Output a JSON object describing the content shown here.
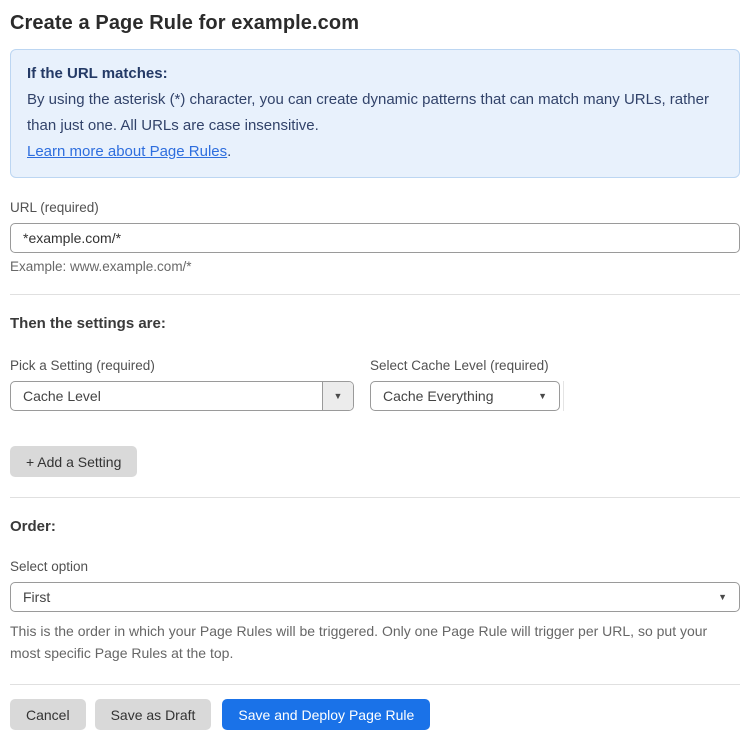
{
  "page": {
    "title": "Create a Page Rule for example.com"
  },
  "info_box": {
    "heading": "If the URL matches:",
    "body": "By using the asterisk (*) character, you can create dynamic patterns that can match many URLs, rather than just one. All URLs are case insensitive.",
    "link_label": "Learn more about Page Rules",
    "link_suffix": "."
  },
  "url_section": {
    "label": "URL (required)",
    "value": "*example.com/*",
    "helper": "Example: www.example.com/*"
  },
  "settings_section": {
    "heading": "Then the settings are:",
    "setting_label": "Pick a Setting (required)",
    "setting_value": "Cache Level",
    "cache_label": "Select Cache Level (required)",
    "cache_value": "Cache Everything",
    "add_button_label": "+ Add a Setting"
  },
  "order_section": {
    "heading": "Order:",
    "label": "Select option",
    "value": "First",
    "helper": "This is the order in which your Page Rules will be triggered. Only one Page Rule will trigger per URL, so put your most specific Page Rules at the top."
  },
  "footer": {
    "cancel_label": "Cancel",
    "save_draft_label": "Save as Draft",
    "save_deploy_label": "Save and Deploy Page Rule"
  },
  "icons": {
    "dropdown_arrow": "▼"
  },
  "colors": {
    "accent_blue": "#1a72e8",
    "info_box_bg": "#e8f1fc",
    "info_box_border": "#bcd6f2",
    "info_text": "#32436a",
    "link_blue": "#2e6ede",
    "button_gray": "#d9d9d9"
  }
}
